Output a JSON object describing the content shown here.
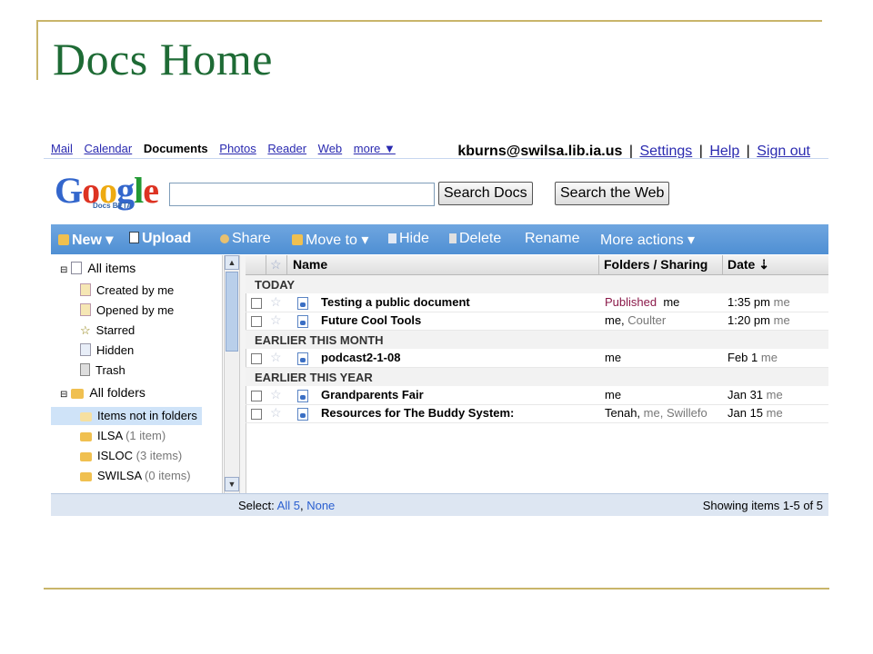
{
  "slide": {
    "title": "Docs Home"
  },
  "topnav": {
    "links": [
      "Mail",
      "Calendar",
      "Documents",
      "Photos",
      "Reader",
      "Web",
      "more ▼"
    ],
    "account": "kburns@swilsa.lib.ia.us",
    "settings": "Settings",
    "help": "Help",
    "signout": "Sign out",
    "sep": "|"
  },
  "logo": {
    "text": "Google",
    "sub": "Docs BETA"
  },
  "search": {
    "value": "",
    "search_docs": "Search Docs",
    "search_web": "Search the Web"
  },
  "toolbar": {
    "new": "New ▾",
    "upload": "Upload",
    "share": "Share",
    "move": "Move to ▾",
    "hide": "Hide",
    "delete": "Delete",
    "rename": "Rename",
    "more": "More actions ▾"
  },
  "sidebar": {
    "items": [
      {
        "label": "All items"
      },
      {
        "label": "Created by me"
      },
      {
        "label": "Opened by me"
      },
      {
        "label": "Starred"
      },
      {
        "label": "Hidden"
      },
      {
        "label": "Trash"
      },
      {
        "label": "All folders"
      },
      {
        "label": "Items not in folders"
      },
      {
        "label": "ILSA",
        "count": "(1 item)"
      },
      {
        "label": "ISLOC",
        "count": "(3 items)"
      },
      {
        "label": "SWILSA",
        "count": "(0 items)"
      }
    ]
  },
  "table": {
    "headers": {
      "name": "Name",
      "folders": "Folders / Sharing",
      "date": "Date ⇣"
    },
    "groups": [
      "TODAY",
      "EARLIER THIS MONTH",
      "EARLIER THIS YEAR"
    ],
    "rows": [
      {
        "name": "Testing a public document",
        "sharing_a": "Published",
        "sharing_b": "me",
        "date": "1:35 pm",
        "by": "me"
      },
      {
        "name": "Future Cool Tools",
        "sharing_a": "me,",
        "sharing_b": "Coulter",
        "date": "1:20 pm",
        "by": "me"
      },
      {
        "name": "podcast2-1-08",
        "sharing_a": "me",
        "sharing_b": "",
        "date": "Feb 1",
        "by": "me"
      },
      {
        "name": "Grandparents Fair",
        "sharing_a": "me",
        "sharing_b": "",
        "date": "Jan 31",
        "by": "me"
      },
      {
        "name": "Resources for The Buddy System:",
        "sharing_a": "Tenah,",
        "sharing_b": "me, Swillefo",
        "date": "Jan 15",
        "by": "me"
      }
    ]
  },
  "footer": {
    "select_label": "Select:",
    "all": "All 5",
    "none": "None",
    "showing": "Showing items 1-5 of 5"
  },
  "colors": {
    "toolbar": "#5b9bd5",
    "title": "#1e6b35",
    "rule": "#c9b56a"
  }
}
